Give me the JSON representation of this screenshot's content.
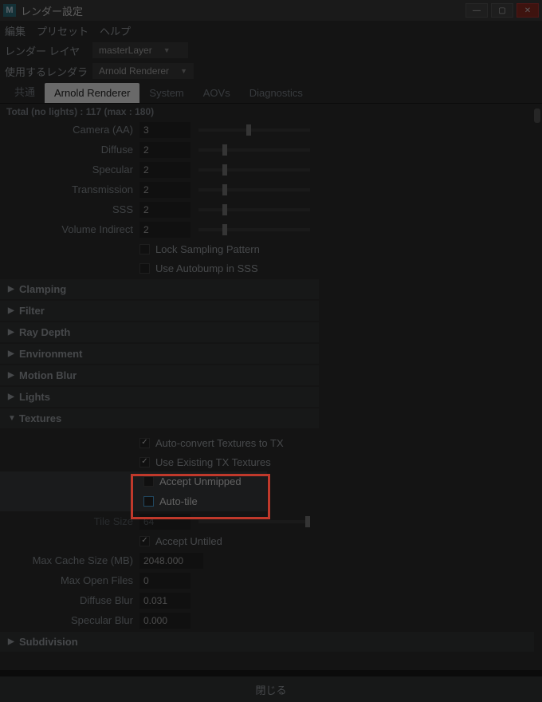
{
  "title": "レンダー設定",
  "app_icon": "M",
  "menus": {
    "edit": "編集",
    "preset": "プリセット",
    "help": "ヘルプ"
  },
  "render_layer": {
    "label": "レンダー レイヤ",
    "value": "masterLayer"
  },
  "renderer": {
    "label": "使用するレンダラ",
    "value": "Arnold Renderer"
  },
  "tabs": {
    "common": "共通",
    "arnold": "Arnold Renderer",
    "system": "System",
    "aovs": "AOVs",
    "diag": "Diagnostics"
  },
  "summary": "Total (no lights) : 117 (max : 180)",
  "sampling": {
    "camera": {
      "label": "Camera (AA)",
      "value": "3"
    },
    "diffuse": {
      "label": "Diffuse",
      "value": "2"
    },
    "specular": {
      "label": "Specular",
      "value": "2"
    },
    "transmission": {
      "label": "Transmission",
      "value": "2"
    },
    "sss": {
      "label": "SSS",
      "value": "2"
    },
    "volume": {
      "label": "Volume Indirect",
      "value": "2"
    },
    "lock": "Lock Sampling Pattern",
    "autobump": "Use Autobump in SSS"
  },
  "sections": {
    "clamping": "Clamping",
    "filter": "Filter",
    "raydepth": "Ray Depth",
    "environment": "Environment",
    "motionblur": "Motion Blur",
    "lights": "Lights",
    "textures": "Textures",
    "subdivision": "Subdivision"
  },
  "textures": {
    "autoconvert": "Auto-convert Textures to TX",
    "useexisting": "Use Existing TX Textures",
    "accept_unmipped": "Accept Unmipped",
    "autotile": "Auto-tile",
    "tilesize": {
      "label": "Tile Size",
      "value": "64"
    },
    "accept_untiled": "Accept Untiled",
    "maxcache": {
      "label": "Max Cache Size (MB)",
      "value": "2048.000"
    },
    "maxopen": {
      "label": "Max Open Files",
      "value": "0"
    },
    "diffuseblur": {
      "label": "Diffuse Blur",
      "value": "0.031"
    },
    "specularblur": {
      "label": "Specular Blur",
      "value": "0.000"
    }
  },
  "footer": {
    "close": "閉じる"
  }
}
